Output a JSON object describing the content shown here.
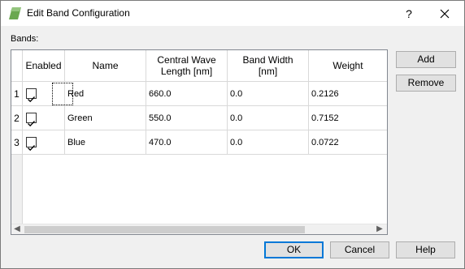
{
  "window": {
    "title": "Edit Band Configuration",
    "help_label": "?"
  },
  "bands_label": "Bands:",
  "table": {
    "columns": [
      "Enabled",
      "Name",
      "Central Wave\nLength [nm]",
      "Band Width\n[nm]",
      "Weight"
    ],
    "rows": [
      {
        "index": "1",
        "enabled": true,
        "name": "Red",
        "central_wave_length": "660.0",
        "band_width": "0.0",
        "weight": "0.2126"
      },
      {
        "index": "2",
        "enabled": true,
        "name": "Green",
        "central_wave_length": "550.0",
        "band_width": "0.0",
        "weight": "0.7152"
      },
      {
        "index": "3",
        "enabled": true,
        "name": "Blue",
        "central_wave_length": "470.0",
        "band_width": "0.0",
        "weight": "0.0722"
      }
    ]
  },
  "side_buttons": {
    "add": "Add",
    "remove": "Remove"
  },
  "footer_buttons": {
    "ok": "OK",
    "cancel": "Cancel",
    "help": "Help"
  },
  "colors": {
    "accent": "#0078d7",
    "checkmark": "#000000",
    "app_icon": "#6aa84f"
  }
}
